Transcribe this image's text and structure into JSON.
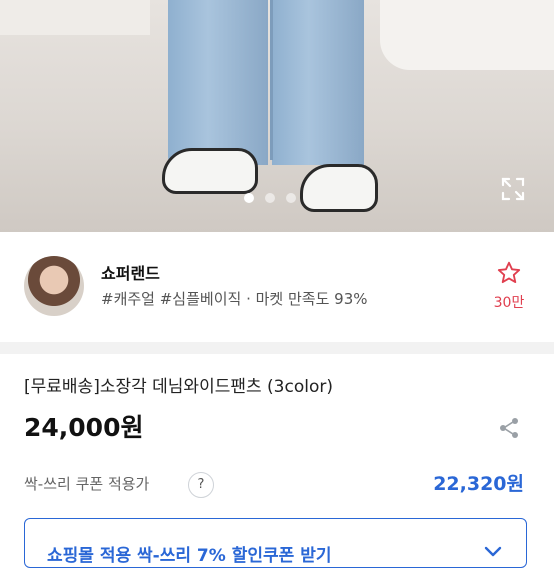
{
  "hero": {
    "alt": "product photo",
    "total_slides": 3,
    "active_slide": 1
  },
  "seller": {
    "name": "쇼퍼랜드",
    "tags": "#캐주얼 #심플베이직 · 마켓 만족도 93%",
    "favorite_count": "30만"
  },
  "product": {
    "title": "[무료배송]소장각 데님와이드팬츠 (3color)",
    "price": "24,000원",
    "coupon_label": "싹-쓰리 쿠폰 적용가",
    "help_symbol": "?",
    "coupon_price": "22,320원",
    "coupon_button": "쇼핑몰 적용 싹-쓰리 7% 할인쿠폰 받기"
  },
  "colors": {
    "accent": "#2a67d6",
    "favorite": "#e03f4f"
  }
}
